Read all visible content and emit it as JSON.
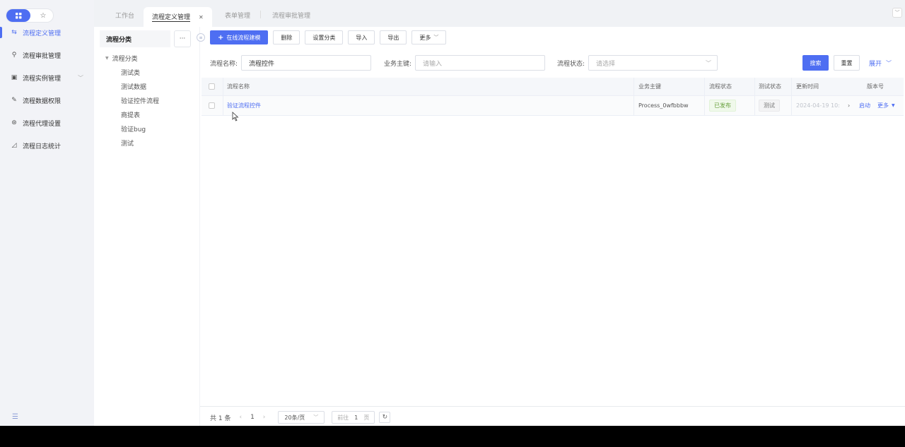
{
  "colors": {
    "accent": "#4e6ef2"
  },
  "nav": {
    "switch_icons": [
      "grid-icon",
      "star-icon"
    ],
    "items": [
      {
        "label": "流程定义管理",
        "icon": "flow-icon",
        "active": true
      },
      {
        "label": "流程审批管理",
        "icon": "stamp-icon"
      },
      {
        "label": "流程实例管理",
        "icon": "instance-icon",
        "has_children": true
      },
      {
        "label": "流程数据权限",
        "icon": "edit-icon"
      },
      {
        "label": "流程代理设置",
        "icon": "proxy-icon"
      },
      {
        "label": "流程日志统计",
        "icon": "chart-icon"
      }
    ]
  },
  "tabs": [
    {
      "label": "工作台"
    },
    {
      "label": "流程定义管理",
      "active": true
    },
    {
      "label": "表单管理"
    },
    {
      "label": "流程审批管理"
    }
  ],
  "category": {
    "title": "流程分类",
    "more": "···",
    "root": "流程分类",
    "children": [
      "测试类",
      "测试数据",
      "验证控件流程",
      "商提表",
      "验证bug",
      "测试"
    ]
  },
  "toolbar": {
    "new_label": "在线流程建模",
    "delete_label": "删除",
    "set_category_label": "设置分类",
    "import_label": "导入",
    "export_label": "导出",
    "more_label": "更多"
  },
  "filters": {
    "name_label": "流程名称:",
    "name_value": "流程控件",
    "key_label": "业务主键:",
    "key_placeholder": "请输入",
    "status_label": "流程状态:",
    "status_placeholder": "请选择",
    "search_label": "搜索",
    "reset_label": "重置",
    "expand_label": "展开"
  },
  "table": {
    "columns": [
      "流程名称",
      "业务主键",
      "流程状态",
      "测试状态",
      "更新时间",
      "版本号"
    ],
    "rows": [
      {
        "name": "验证流程控件",
        "key": "Process_0wfbbbw",
        "status": "已发布",
        "test_status": "测试",
        "updated": "2024-04-19 10:",
        "action_start": "启动",
        "action_more": "更多"
      }
    ]
  },
  "pager": {
    "total": "共 1 条",
    "current_page": "1",
    "page_size": "20条/页",
    "goto_prefix": "前往",
    "goto_value": "1",
    "goto_suffix": "页"
  }
}
